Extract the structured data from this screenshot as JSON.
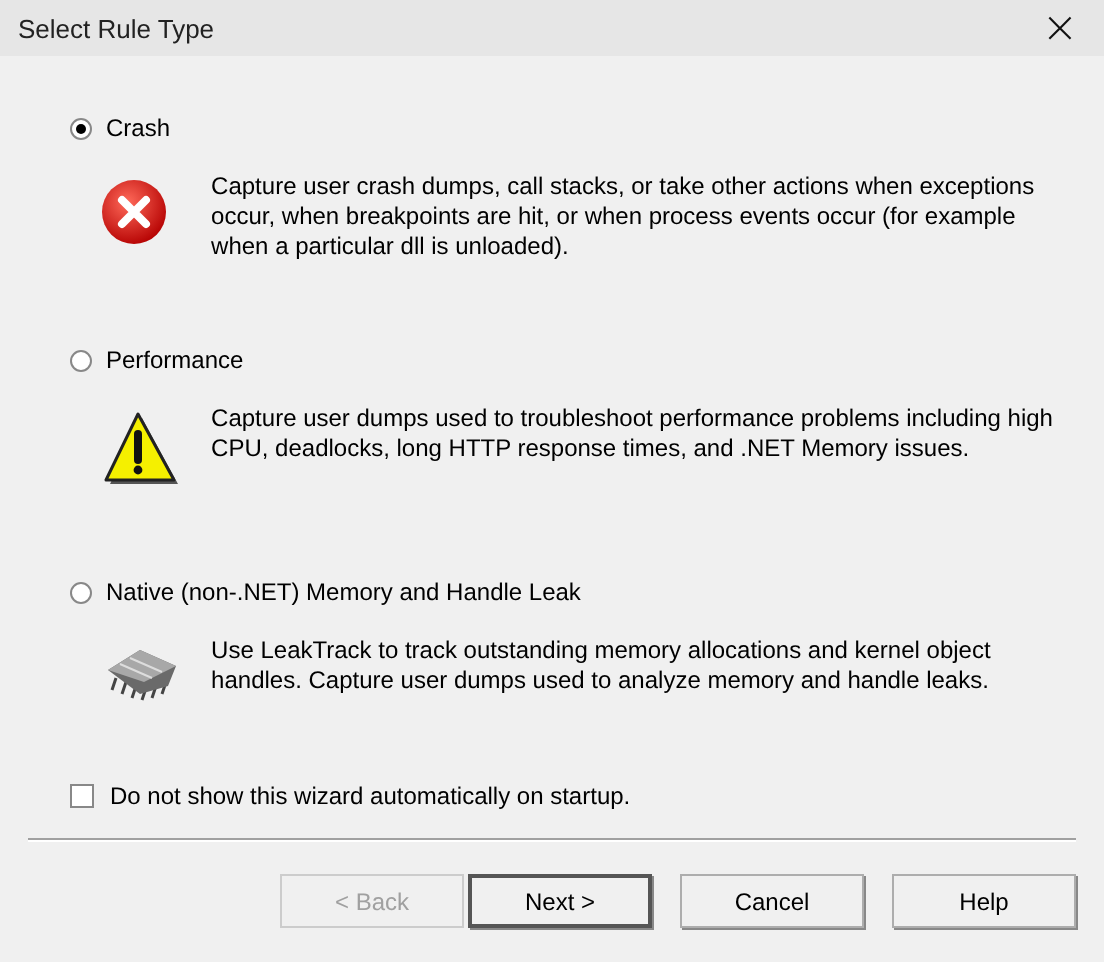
{
  "window": {
    "title": "Select Rule Type",
    "close": "×"
  },
  "options": [
    {
      "label": "Crash",
      "selected": true,
      "kind": "error",
      "description": "Capture user crash dumps, call stacks, or take other actions when exceptions occur, when breakpoints are hit, or when process events occur (for example when a particular dll is unloaded)."
    },
    {
      "label": "Performance",
      "selected": false,
      "kind": "warning",
      "description": "Capture user dumps used to troubleshoot performance problems including high CPU, deadlocks, long HTTP response times, and .NET Memory issues."
    },
    {
      "label": "Native (non-.NET) Memory and Handle Leak",
      "selected": false,
      "kind": "chip",
      "description": "Use LeakTrack to track outstanding memory allocations and kernel object handles. Capture user dumps used to analyze memory and handle leaks."
    }
  ],
  "startup_checkbox": {
    "label": "Do not show this wizard automatically on startup.",
    "checked": false
  },
  "buttons": [
    {
      "label": "< Back",
      "disabled": true,
      "default": false
    },
    {
      "label": "Next >",
      "disabled": false,
      "default": true
    },
    {
      "label": "Cancel",
      "disabled": false,
      "default": false
    },
    {
      "label": "Help",
      "disabled": false,
      "default": false
    }
  ]
}
